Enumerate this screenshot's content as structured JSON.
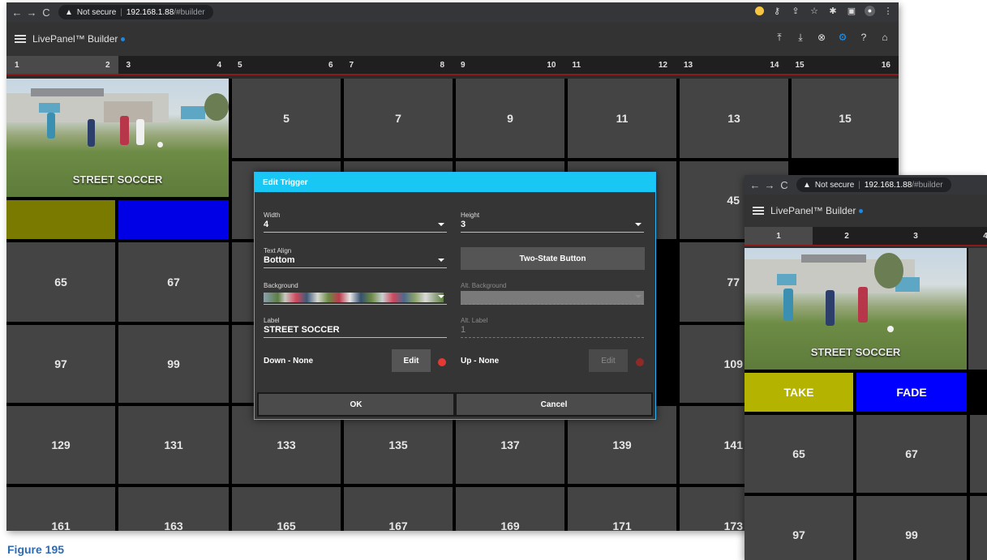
{
  "browser": {
    "security_label": "Not secure",
    "host": "192.168.1.88",
    "path": "/#builder"
  },
  "app": {
    "title": "LivePanel™ Builder",
    "status_color": "#1e88e5"
  },
  "tabs": [
    "1",
    "2",
    "3",
    "4",
    "5",
    "6",
    "7",
    "8",
    "9",
    "10",
    "11",
    "12",
    "13",
    "14",
    "15",
    "16"
  ],
  "active_tab": "1",
  "grid": {
    "image_button_label": "STREET SOCCER",
    "colors": {
      "take": "#7a7a00",
      "fade": "#0000e6",
      "cell": "#444444"
    },
    "row1": [
      "5",
      "7",
      "9",
      "11",
      "13",
      "15"
    ],
    "row2_right": "45",
    "row3": [
      "65",
      "67",
      "77"
    ],
    "row4": [
      "97",
      "99",
      "109"
    ],
    "row5": [
      "129",
      "131",
      "133",
      "135",
      "137",
      "139",
      "141"
    ],
    "row6": [
      "161",
      "163",
      "165",
      "167",
      "169",
      "171",
      "173"
    ]
  },
  "dialog": {
    "title": "Edit Trigger",
    "width_label": "Width",
    "width_value": "4",
    "height_label": "Height",
    "height_value": "3",
    "text_align_label": "Text Align",
    "text_align_value": "Bottom",
    "two_state_button": "Two-State Button",
    "background_label": "Background",
    "alt_background_label": "Alt. Background",
    "label_label": "Label",
    "label_value": "STREET SOCCER",
    "alt_label_label": "Alt. Label",
    "alt_label_value": "1",
    "down_label": "Down - None",
    "down_edit": "Edit",
    "up_label": "Up - None",
    "up_edit": "Edit",
    "ok": "OK",
    "cancel": "Cancel",
    "accent": "#18c7f3"
  },
  "second_window": {
    "security_label": "Not secure",
    "host": "192.168.1.88",
    "path": "/#builder",
    "app_title": "LivePanel™ Builder",
    "tabs": [
      "1",
      "2",
      "3",
      "4",
      "5"
    ],
    "image_button_label": "STREET SOCCER",
    "take_label": "TAKE",
    "fade_label": "FADE",
    "cells": [
      "65",
      "67",
      "97",
      "99"
    ]
  },
  "caption": "Figure 195"
}
